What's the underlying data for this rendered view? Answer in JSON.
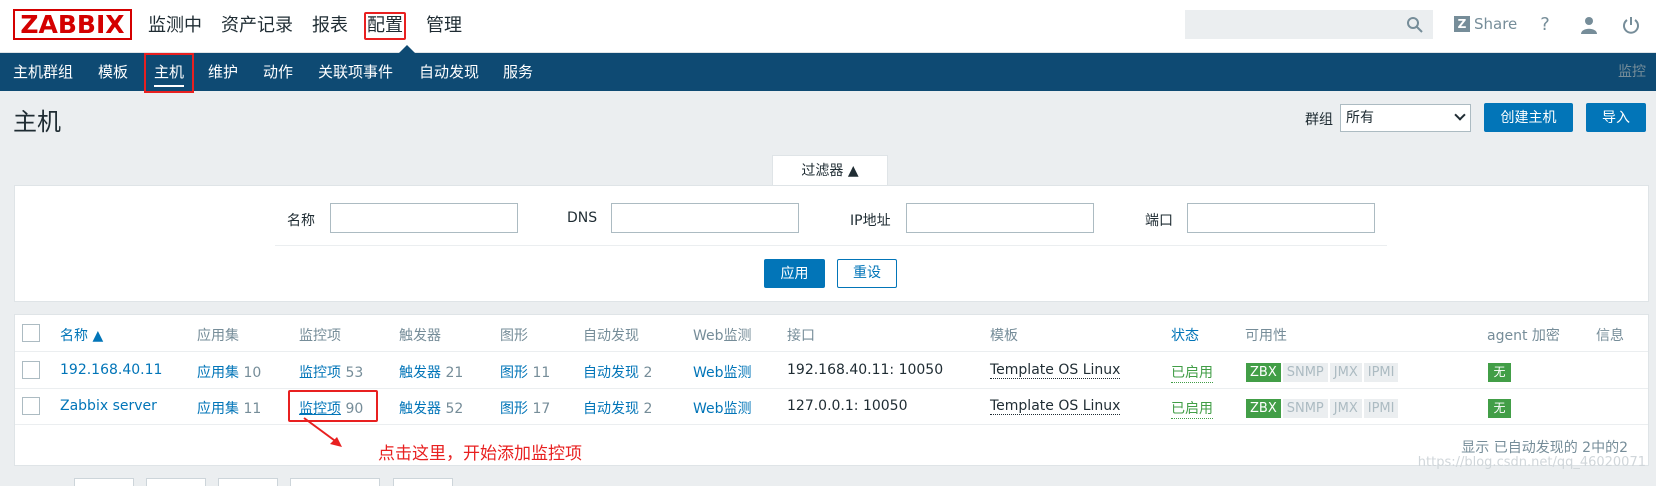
{
  "topbar": {
    "logo": "ZABBIX",
    "menu": [
      "监测中",
      "资产记录",
      "报表",
      "配置",
      "管理"
    ],
    "search_placeholder": "",
    "share_label": "Share",
    "help_icon": "?"
  },
  "subnav": {
    "items": [
      "主机群组",
      "模板",
      "主机",
      "维护",
      "动作",
      "关联项事件",
      "自动发现",
      "服务"
    ],
    "right_label": "监控"
  },
  "header": {
    "title": "主机",
    "group_label": "群组",
    "group_value": "所有",
    "create_button": "创建主机",
    "import_button": "导入"
  },
  "filter": {
    "tab_label": "过滤器 ▲",
    "name_label": "名称",
    "dns_label": "DNS",
    "ip_label": "IP地址",
    "port_label": "端口",
    "apply_button": "应用",
    "reset_button": "重设"
  },
  "table": {
    "columns": {
      "name": "名称 ▲",
      "apps": "应用集",
      "items": "监控项",
      "triggers": "触发器",
      "graphs": "图形",
      "discovery": "自动发现",
      "web": "Web监测",
      "interface": "接口",
      "templates": "模板",
      "status": "状态",
      "availability": "可用性",
      "encryption": "agent 加密",
      "info": "信息"
    },
    "rows": [
      {
        "name": "192.168.40.11",
        "apps_label": "应用集",
        "apps_count": "10",
        "items_label": "监控项",
        "items_count": "53",
        "triggers_label": "触发器",
        "triggers_count": "21",
        "graphs_label": "图形",
        "graphs_count": "11",
        "discovery_label": "自动发现",
        "discovery_count": "2",
        "web": "Web监测",
        "interface": "192.168.40.11: 10050",
        "template": "Template OS Linux",
        "status": "已启用",
        "avail": [
          "ZBX",
          "SNMP",
          "JMX",
          "IPMI"
        ],
        "encryption": "无"
      },
      {
        "name": "Zabbix server",
        "apps_label": "应用集",
        "apps_count": "11",
        "items_label": "监控项",
        "items_count": "90",
        "triggers_label": "触发器",
        "triggers_count": "52",
        "graphs_label": "图形",
        "graphs_count": "17",
        "discovery_label": "自动发现",
        "discovery_count": "2",
        "web": "Web监测",
        "interface": "127.0.0.1: 10050",
        "template": "Template OS Linux",
        "status": "已启用",
        "avail": [
          "ZBX",
          "SNMP",
          "JMX",
          "IPMI"
        ],
        "encryption": "无"
      }
    ],
    "footer": "显示 已自动发现的 2中的2"
  },
  "annotation": "点击这里，开始添加监控项",
  "watermark": "https://blog.csdn.net/qq_46020071",
  "colors": {
    "brand": "#d40000",
    "nav_bg": "#0e4a73",
    "link": "#0275b8",
    "ok": "#429e47",
    "highlight": "#e82020"
  }
}
